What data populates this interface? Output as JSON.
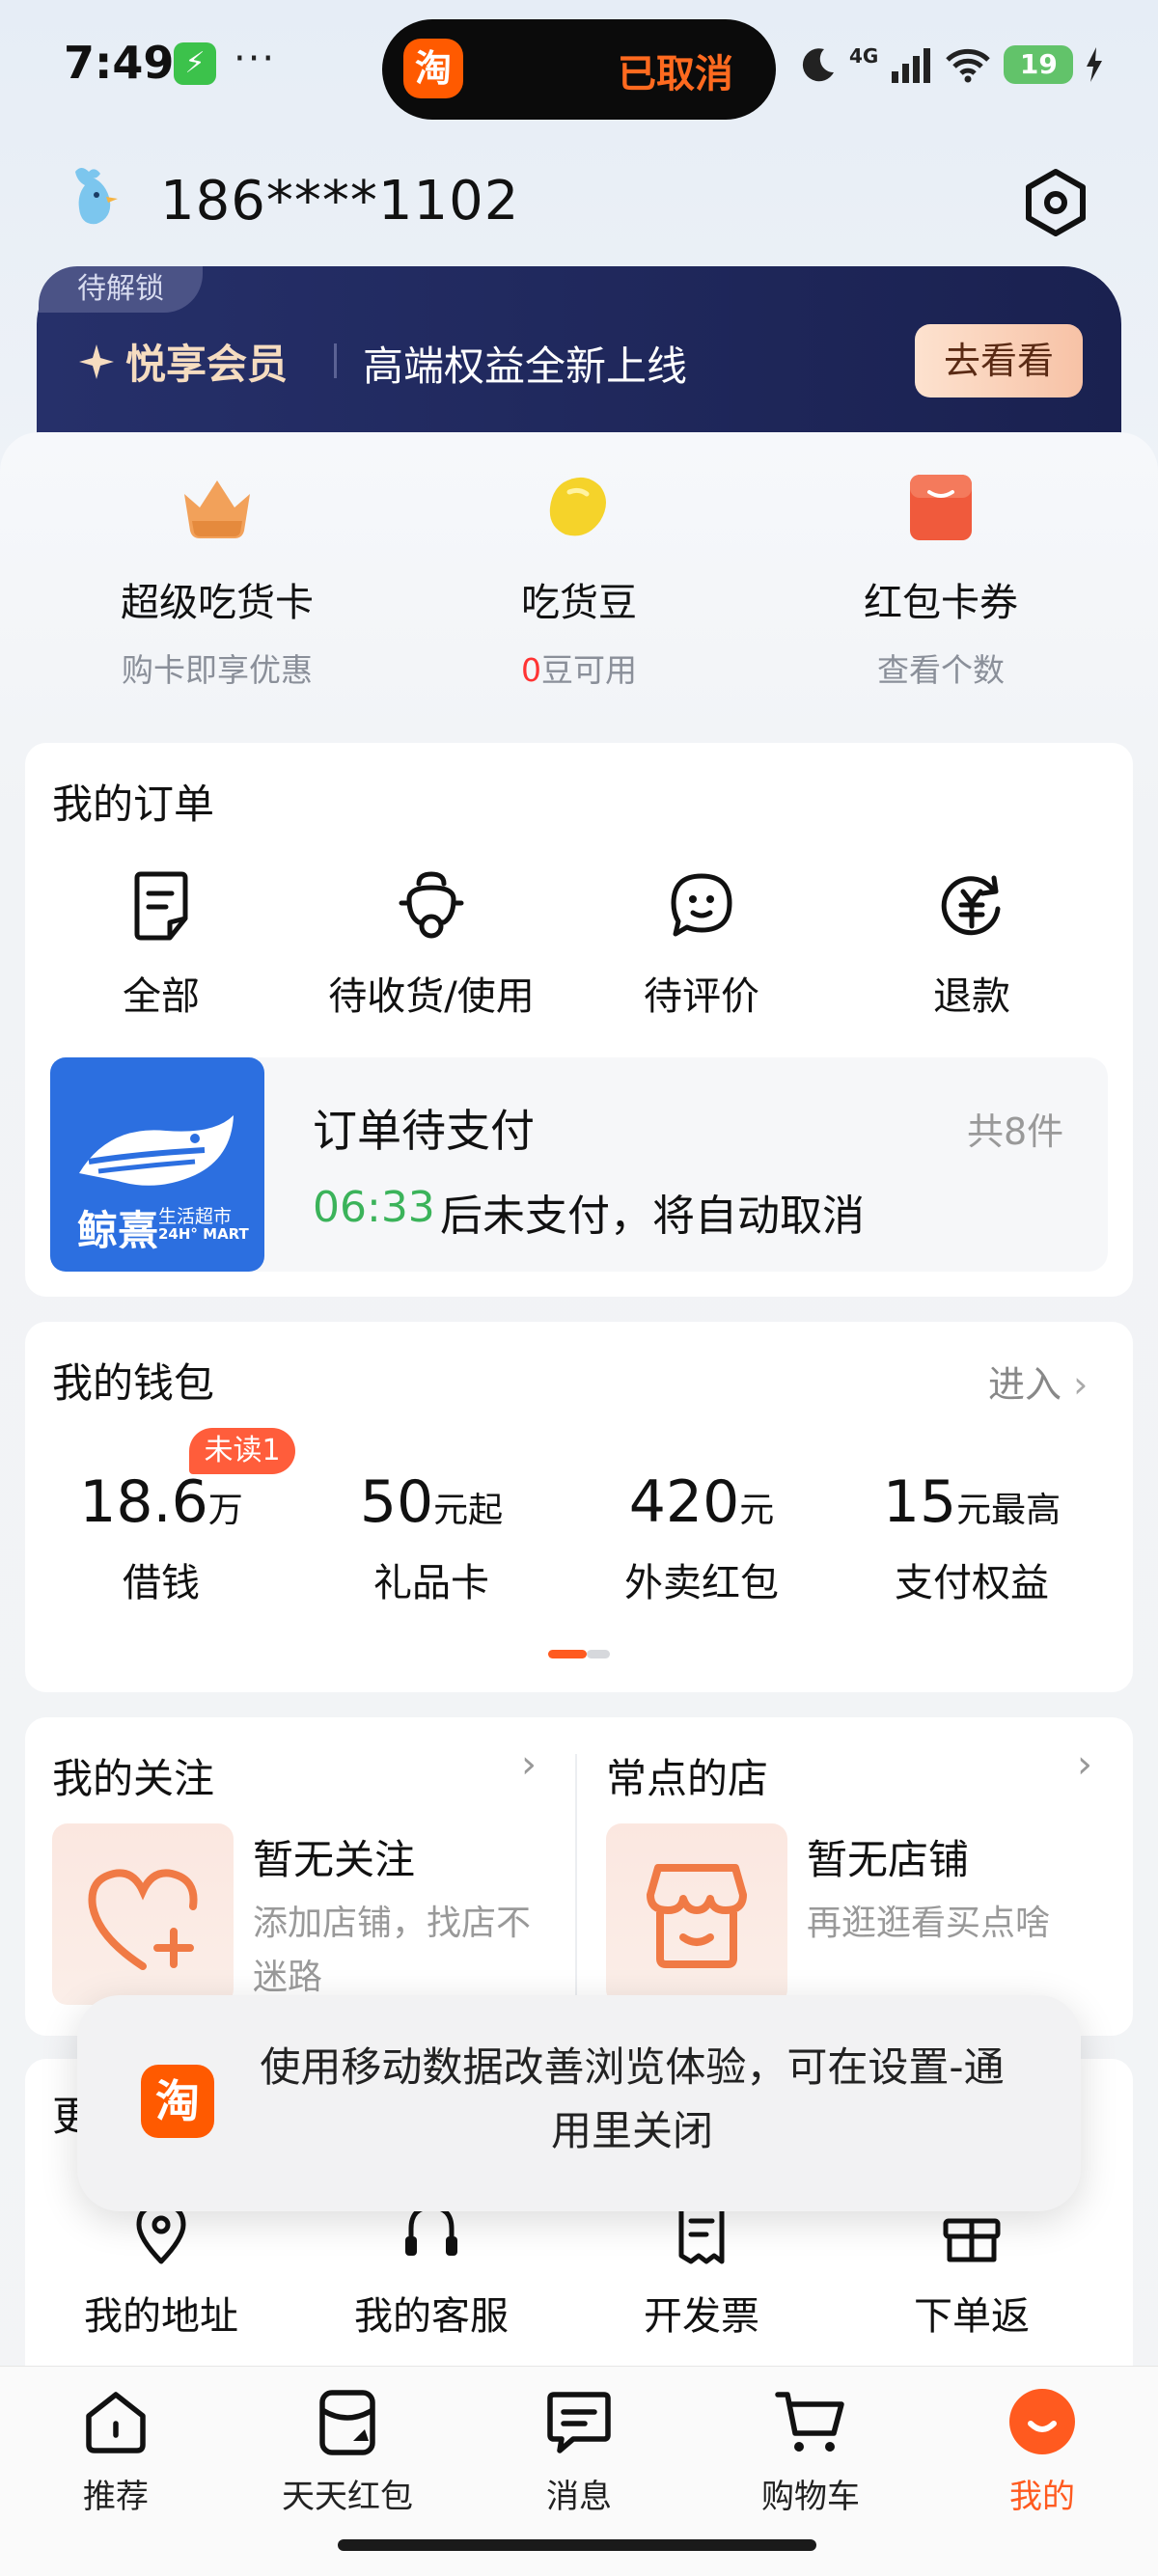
{
  "status_bar": {
    "time": "7:49",
    "app_icon_glyph": "⚡",
    "more_dots": "···",
    "island_logo": "淘",
    "island_text": "已取消",
    "network": "4G",
    "battery": "19"
  },
  "user": {
    "phone": "186****1102",
    "avatar_icon": "bird-avatar-icon",
    "settings_icon": "settings-hexagon-icon"
  },
  "vip": {
    "lock_tag": "待解锁",
    "title": "悦享会员",
    "subtitle": "高端权益全新上线",
    "button": "去看看"
  },
  "quick": [
    {
      "title": "超级吃货卡",
      "sub": "购卡即享优惠",
      "icon": "crown-icon"
    },
    {
      "title": "吃货豆",
      "sub_red": "0",
      "sub": "豆可用",
      "icon": "bean-icon"
    },
    {
      "title": "红包卡券",
      "sub": "查看个数",
      "icon": "red-envelope-icon"
    }
  ],
  "orders": {
    "title": "我的订单",
    "items": [
      {
        "label": "全部",
        "icon": "document-icon"
      },
      {
        "label": "待收货/使用",
        "icon": "scooter-icon"
      },
      {
        "label": "待评价",
        "icon": "chat-bubble-icon"
      },
      {
        "label": "退款",
        "icon": "refund-icon"
      }
    ],
    "pending": {
      "store_name": "鲸熹",
      "store_tag": "生活超市",
      "store_tag2": "24H° MART",
      "title": "订单待支付",
      "count": "共8件",
      "timer": "06:33",
      "message": "后未支付，将自动取消"
    }
  },
  "wallet": {
    "title": "我的钱包",
    "enter": "进入",
    "badge": "未读1",
    "items": [
      {
        "value": "18.6",
        "unit": "万",
        "label": "借钱"
      },
      {
        "value": "50",
        "unit": "元起",
        "label": "礼品卡"
      },
      {
        "value": "420",
        "unit": "元",
        "label": "外卖红包"
      },
      {
        "value": "15",
        "unit": "元最高",
        "label": "支付权益"
      }
    ]
  },
  "follow": {
    "title": "我的关注",
    "empty_title": "暂无关注",
    "empty_sub": "添加店铺，找店不迷路"
  },
  "frequent": {
    "title": "常点的店",
    "empty_title": "暂无店铺",
    "empty_sub": "再逛逛看买点啥"
  },
  "more": {
    "partial_title": "更",
    "items": [
      {
        "label": "我的地址",
        "icon": "location-pin-icon"
      },
      {
        "label": "我的客服",
        "icon": "headset-icon"
      },
      {
        "label": "开发票",
        "icon": "receipt-icon"
      },
      {
        "label": "下单返",
        "icon": "gift-box-icon"
      }
    ]
  },
  "toast": {
    "logo": "淘",
    "text": "使用移动数据改善浏览体验，可在设置-通用里关闭"
  },
  "tabs": [
    {
      "label": "推荐",
      "icon": "home-icon"
    },
    {
      "label": "天天红包",
      "icon": "red-packet-icon"
    },
    {
      "label": "消息",
      "icon": "message-icon"
    },
    {
      "label": "购物车",
      "icon": "cart-icon"
    },
    {
      "label": "我的",
      "icon": "profile-icon",
      "active": true
    }
  ],
  "colors": {
    "accent": "#ff5a1f",
    "vip_bg": "#1f2759",
    "timer_green": "#3bb35a",
    "badge_red": "#ff5d3b"
  }
}
